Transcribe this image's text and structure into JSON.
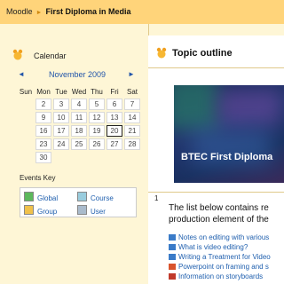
{
  "breadcrumb": {
    "root": "Moodle",
    "separator": "►",
    "current": "First Diploma in Media"
  },
  "calendar": {
    "title": "Calendar",
    "month_label": "November 2009",
    "prev": "◄",
    "next": "►",
    "weekdays": [
      "Sun",
      "Mon",
      "Tue",
      "Wed",
      "Thu",
      "Fri",
      "Sat"
    ],
    "weeks": [
      [
        "",
        "2",
        "3",
        "4",
        "5",
        "6",
        "7"
      ],
      [
        "",
        "9",
        "10",
        "11",
        "12",
        "13",
        "14"
      ],
      [
        "",
        "16",
        "17",
        "18",
        "19",
        "20",
        "21"
      ],
      [
        "",
        "23",
        "24",
        "25",
        "26",
        "27",
        "28"
      ],
      [
        "",
        "30",
        "",
        "",
        "",
        "",
        ""
      ]
    ],
    "today": "20"
  },
  "events_key": {
    "title": "Events Key",
    "items": [
      {
        "label": "Global",
        "color": "#5cb85c"
      },
      {
        "label": "Course",
        "color": "#99ccdd"
      },
      {
        "label": "Group",
        "color": "#f0c14b"
      },
      {
        "label": "User",
        "color": "#aabbcc"
      }
    ]
  },
  "topic_outline": {
    "title": "Topic outline",
    "banner_text": "BTEC First Diploma",
    "section_number": "1",
    "intro_line1": "The list below contains re",
    "intro_line2": "production element of the",
    "resources": [
      {
        "label": "Notes on editing with various",
        "icon": "people-icon"
      },
      {
        "label": "What is video editing?",
        "icon": "people-icon"
      },
      {
        "label": "Writing a Treatment for Video",
        "icon": "people-icon"
      },
      {
        "label": "Powerpoint on framing and s",
        "icon": "powerpoint-icon"
      },
      {
        "label": "Information on storyboards",
        "icon": "pdf-icon"
      }
    ]
  }
}
